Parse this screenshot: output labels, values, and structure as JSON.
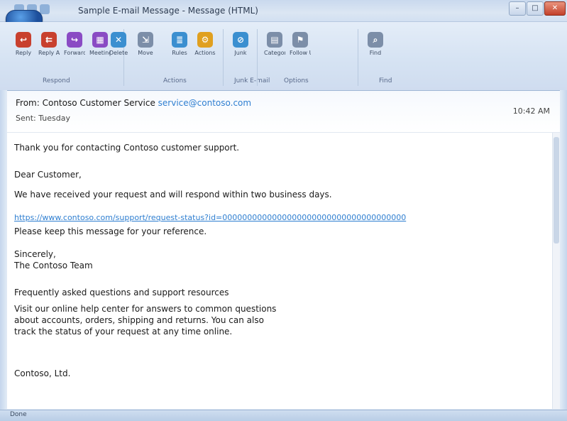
{
  "window": {
    "title": "Sample E-mail Message - Message (HTML)",
    "controls": {
      "minimize": "–",
      "maximize": "□",
      "close": "✕"
    }
  },
  "ribbon": {
    "buttons": [
      {
        "label": "Reply",
        "icon": "reply-icon",
        "color": "#c8402e"
      },
      {
        "label": "Reply All",
        "icon": "reply-all-icon",
        "color": "#c8402e"
      },
      {
        "label": "Forward",
        "icon": "forward-icon",
        "color": "#8a4bc4"
      },
      {
        "label": "Meeting",
        "icon": "meeting-icon",
        "color": "#8a4bc4"
      },
      {
        "label": "Delete",
        "icon": "delete-icon",
        "color": "#3b8fd0"
      },
      {
        "label": "Move",
        "icon": "move-icon",
        "color": "#7c8ea8"
      },
      {
        "label": "Rules",
        "icon": "rules-icon",
        "color": "#3b8fd0"
      },
      {
        "label": "Actions",
        "icon": "actions-icon",
        "color": "#e0a020"
      },
      {
        "label": "Junk",
        "icon": "junk-icon",
        "color": "#3b8fd0"
      },
      {
        "label": "Categorize",
        "icon": "categorize-icon",
        "color": "#7c8ea8"
      },
      {
        "label": "Follow Up",
        "icon": "follow-up-icon",
        "color": "#7c8ea8"
      },
      {
        "label": "Find",
        "icon": "find-icon",
        "color": "#7c8ea8"
      }
    ],
    "groups": [
      "Respond",
      "Actions",
      "Junk E-mail",
      "Options",
      "Find"
    ]
  },
  "header": {
    "from_label": "From:",
    "from_name": "Contoso Customer Service",
    "from_address": "service@contoso.com",
    "date_line": "Sent: Tuesday",
    "time": "10:42 AM"
  },
  "body": {
    "line1": "Thank you for contacting Contoso customer support.",
    "greeting": "Dear Customer,",
    "line2": "We have received your request and will respond within two business days.",
    "link": "https://www.contoso.com/support/request-status?id=0000000000000000000000000000000000000",
    "line3": "Please keep this message for your reference.",
    "sig1": "Sincerely,",
    "sig2": "The Contoso Team",
    "para_heading": "Frequently asked questions and support resources",
    "para_lines": [
      "Visit our online help center for answers to common questions",
      "about accounts, orders, shipping and returns. You can also",
      "track the status of your request at any time online."
    ],
    "closing": "Contoso, Ltd."
  },
  "status": {
    "text": "Done"
  }
}
